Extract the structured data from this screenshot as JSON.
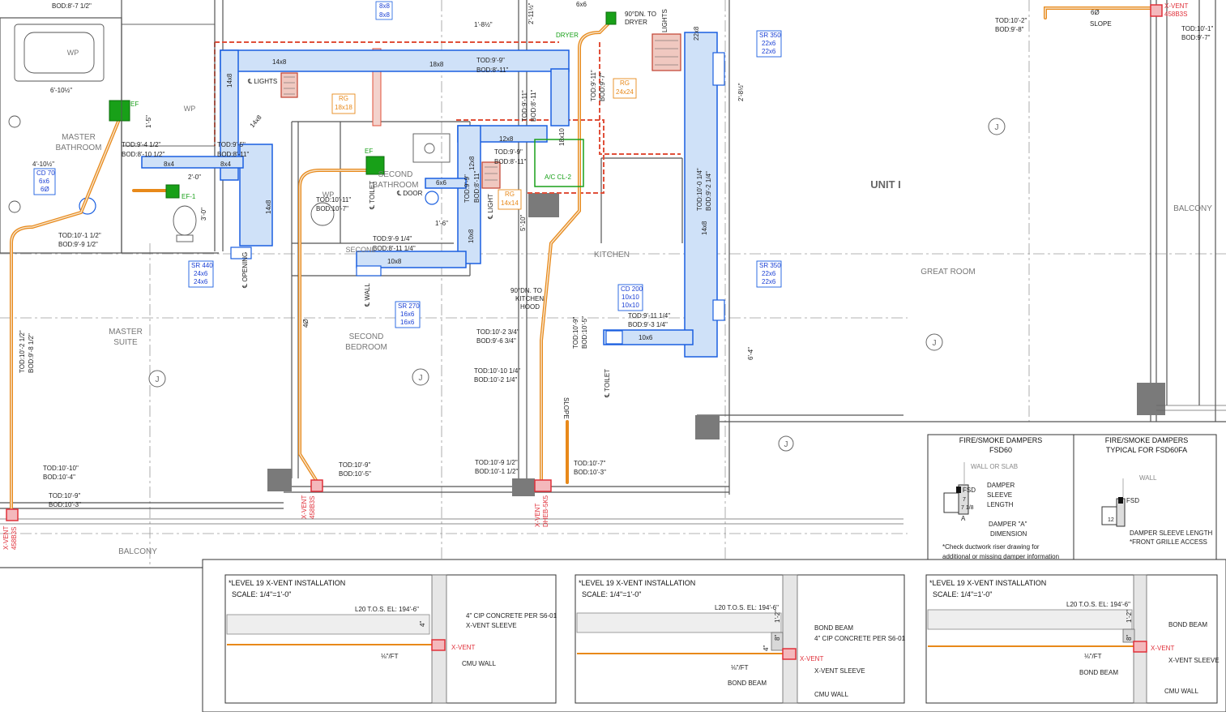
{
  "rooms": {
    "master_bathroom": [
      "MASTER",
      "BATHROOM"
    ],
    "master_suite": [
      "MASTER",
      "SUITE"
    ],
    "second_bathroom": [
      "SECOND",
      "BATHROOM"
    ],
    "second_bedroom": [
      "SECOND",
      "BEDROOM"
    ],
    "kitchen": "KITCHEN",
    "unit": "UNIT I",
    "great_room": "GREAT ROOM",
    "balcony_bottom": "BALCONY",
    "balcony_right": "BALCONY",
    "toilet": "TOILET",
    "toilet2": "TOILET",
    "wp1": "WP",
    "wp2": "WP",
    "wp3": "WP",
    "second": "SECONL"
  },
  "ducts": {
    "d14x8": "14x8",
    "d18x8": "18x8",
    "d14x8b": "14x8",
    "d14x8c": "14x8",
    "d12x8": "12x8",
    "d10x8": "10x8",
    "d10x8b": "10x8",
    "d12x8b": "12x8",
    "d6x6": "6x6",
    "d8x4": "8x4",
    "d8x4b": "8x4",
    "d10x6": "10x6",
    "d14x8d": "14x8",
    "d22x8": "22x8",
    "d18x10": "18x10",
    "d6x6top": "6x6",
    "d8x8a": "8x8",
    "d8x8b": "8x8"
  },
  "dims": {
    "tod_99": [
      "TOD:9'-9\"",
      "BOD:8'-11\""
    ],
    "tod_95": [
      "TOD:9'-5\"",
      "BOD:8'-11\""
    ],
    "tod_941": [
      "TOD:9'-4 1/2\"",
      "BOD:8'-10 1/2\""
    ],
    "tod_911a": [
      "TOD:9'-11\"",
      "BOD:8'-11\""
    ],
    "tod_911b": [
      "TOD:9'-11\"",
      "BOD:9'-7\""
    ],
    "tod_99b": [
      "TOD:9'-9\"",
      "BOD:8'-11\""
    ],
    "tod_99c": [
      "TOD:9'-9\"",
      "BOD:8'-11\""
    ],
    "tod_1011a": [
      "TOD:10'-11\"",
      "BOD:10'-7\""
    ],
    "tod_991": [
      "TOD:9'-9 1/4\"",
      "BOD:8'-11 1/4\""
    ],
    "tod_1011b": [
      "TOD:10'-1 1/2\"",
      "BOD:9'-9 1/2\""
    ],
    "tod_1023": [
      "TOD:10'-2 3/4\"",
      "BOD:9'-6 3/4\""
    ],
    "tod_1010": [
      "TOD:10'-10 1/4\"",
      "BOD:10'-2 1/4\""
    ],
    "tod_1093": [
      "TOD:10'-9\"",
      "BOD:10'-5\""
    ],
    "tod_9111": [
      "TOD:9'-11 1/4\"",
      "BOD:9'-3 1/4\""
    ],
    "tod_1001": [
      "TOD:10'-0 1/4\"",
      "BOD:9'-2 1/4\""
    ],
    "tod_1021": [
      "TOD:10'-2 1/2\"",
      "BOD:9'-8 1/2\""
    ],
    "tod_1010b": [
      "TOD:10'-10\"",
      "BOD:10'-4\""
    ],
    "tod_109": [
      "TOD:10'-9\"",
      "BOD:10'-3\""
    ],
    "tod_109b": [
      "TOD:10'-9\"",
      "BOD:10'-5\""
    ],
    "tod_10912": [
      "TOD:10'-9 1/2\"",
      "BOD:10'-1 1/2\""
    ],
    "tod_107": [
      "TOD:10'-7\"",
      "BOD:10'-3\""
    ],
    "tod_102": [
      "TOD:10'-2\"",
      "BOD:9'-8\""
    ],
    "tod_101": [
      "TOD:10'-1\"",
      "BOD:9'-7\""
    ],
    "bod_top": "BOD:8'-7 1/2\""
  },
  "grilles": {
    "sr350a": [
      "SR 350",
      "22x6",
      "22x6"
    ],
    "sr350b": [
      "SR 350",
      "22x6",
      "22x6"
    ],
    "sr440": [
      "SR 440",
      "24x6",
      "24x6"
    ],
    "sr270": [
      "SR 270",
      "16x6",
      "16x6"
    ],
    "cd200": [
      "CD 200",
      "10x10",
      "10x10"
    ],
    "cd70": [
      "CD 70",
      "6x6",
      "6Ø"
    ],
    "rg18": [
      "RG",
      "18x18"
    ],
    "rg24": [
      "RG",
      "24x24"
    ],
    "rg14": [
      "RG",
      "14x14"
    ]
  },
  "labels": {
    "lights1": "℄ LIGHTS",
    "lights2": "LIGHTS",
    "light3": "℄ LIGHT",
    "opening": "℄ OPENING",
    "toilet_cl": "℄ TOILET",
    "door_cl": "℄ DOOR",
    "wall_cl": "℄ WALL",
    "toilet_cl2": "℄ TOILET",
    "dryer": "DRYER",
    "to_dryer": [
      "90°DN. TO",
      "DRYER"
    ],
    "to_hood": [
      "90°DN. TO",
      "KITCHEN",
      "HOOD"
    ],
    "acc_l2": "A/C CL-2",
    "ef": "EF",
    "ef1": "EF-1",
    "ef2": "EF",
    "slope": "SLOPE",
    "slope2": "SLOPE",
    "xvent1": [
      "X-VENT",
      "458B3S"
    ],
    "xvent2": [
      "X-VENT",
      "458B3S"
    ],
    "xvent3": [
      "X-VENT",
      "DHEB-5K5"
    ],
    "xvent4": [
      "X-VENT",
      "458B3S"
    ],
    "six_dia": "6Ø",
    "four_dia": "4Ø",
    "dim_640": "6'-10½\"",
    "dim_410": "4'-10½\"",
    "dim_15": "1'-5\"",
    "dim_20": "2'-0\"",
    "dim_30": "3'-0\"",
    "dim_64": "6'-4\"",
    "dim_510": "5'-10\"",
    "dim_16": "1'-6\"",
    "dim_186": "1'-8½\"",
    "dim_211": "2'-11½\"",
    "dim_28": "2'-8½\""
  },
  "dampers": {
    "left_title": [
      "FIRE/SMOKE DAMPERS",
      "FSD60"
    ],
    "right_title": [
      "FIRE/SMOKE DAMPERS",
      "TYPICAL FOR FSD60FA"
    ],
    "wall_or_slab": "WALL OR SLAB",
    "wall": "WALL",
    "fsd": "FSD",
    "fsd2": "FSD",
    "damper_sleeve": [
      "DAMPER",
      "SLEEVE",
      "LENGTH"
    ],
    "damper_a": [
      "DAMPER \"A\"",
      "DIMENSION"
    ],
    "sleeve_length": "DAMPER SLEEVE LENGTH",
    "front_grille": "*FRONT GRILLE ACCESS",
    "note": [
      "*Check ductwork riser drawing for",
      "additional or missing damper information"
    ],
    "dim_a": "A",
    "dim_12": "12",
    "dim_7": "7",
    "dim_712": "7 1/8"
  },
  "details": [
    {
      "title": "*LEVEL 19 X-VENT INSTALLATION",
      "scale": "SCALE: 1/4\"=1'-0\"",
      "elev": "L20 T.O.S. EL: 194'-6\"",
      "labels": [
        "4\" CIP CONCRETE PER S6-01",
        "X-VENT SLEEVE",
        "X-VENT",
        "CMU WALL"
      ],
      "slope": "⅛\"/FT",
      "dim": "4\""
    },
    {
      "title": "*LEVEL 19 X-VENT INSTALLATION",
      "scale": "SCALE: 1/4\"=1'-0\"",
      "elev": "L20 T.O.S. EL: 194'-6\"",
      "labels": [
        "BOND BEAM",
        "4\" CIP CONCRETE PER S6-01",
        "X-VENT",
        "X-VENT SLEEVE",
        "BOND BEAM",
        "CMU WALL"
      ],
      "slope": "⅛\"/FT",
      "dim": [
        "1'-2\"",
        "8\"",
        "4\""
      ]
    },
    {
      "title": "*LEVEL 19 X-VENT INSTALLATION",
      "scale": "SCALE: 1/4\"=1'-0\"",
      "elev": "L20 T.O.S. EL: 194'-6\"",
      "labels": [
        "BOND BEAM",
        "X-VENT",
        "X-VENT SLEEVE",
        "BOND BEAM",
        "CMU WALL"
      ],
      "slope": "⅛\"/FT",
      "dim": [
        "1'-2\"",
        "8\""
      ]
    }
  ],
  "colors": {
    "supply": "#1a5fe0",
    "supply_fill": "#cfe1f8",
    "exhaust": "#e8891a",
    "exhaust_fill": "#f6e3c9",
    "fan": "#18a018",
    "rated": "#e0503a",
    "xvent": "#e0303a",
    "wall": "#555555",
    "grid": "#888888"
  }
}
